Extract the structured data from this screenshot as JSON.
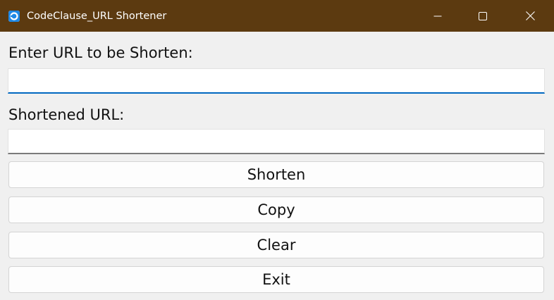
{
  "window": {
    "title": "CodeClause_URL Shortener",
    "app_icon": "app-logo-icon",
    "controls": {
      "minimize_icon": "minimize-icon",
      "maximize_icon": "maximize-icon",
      "close_icon": "close-icon"
    }
  },
  "form": {
    "url_label": "Enter URL to be Shorten:",
    "url_value": "",
    "short_label": "Shortened URL:",
    "short_value": ""
  },
  "buttons": {
    "shorten": "Shorten",
    "copy": "Copy",
    "clear": "Clear",
    "exit": "Exit"
  },
  "colors": {
    "titlebar": "#5c3a10",
    "focus_accent": "#0067c0"
  }
}
